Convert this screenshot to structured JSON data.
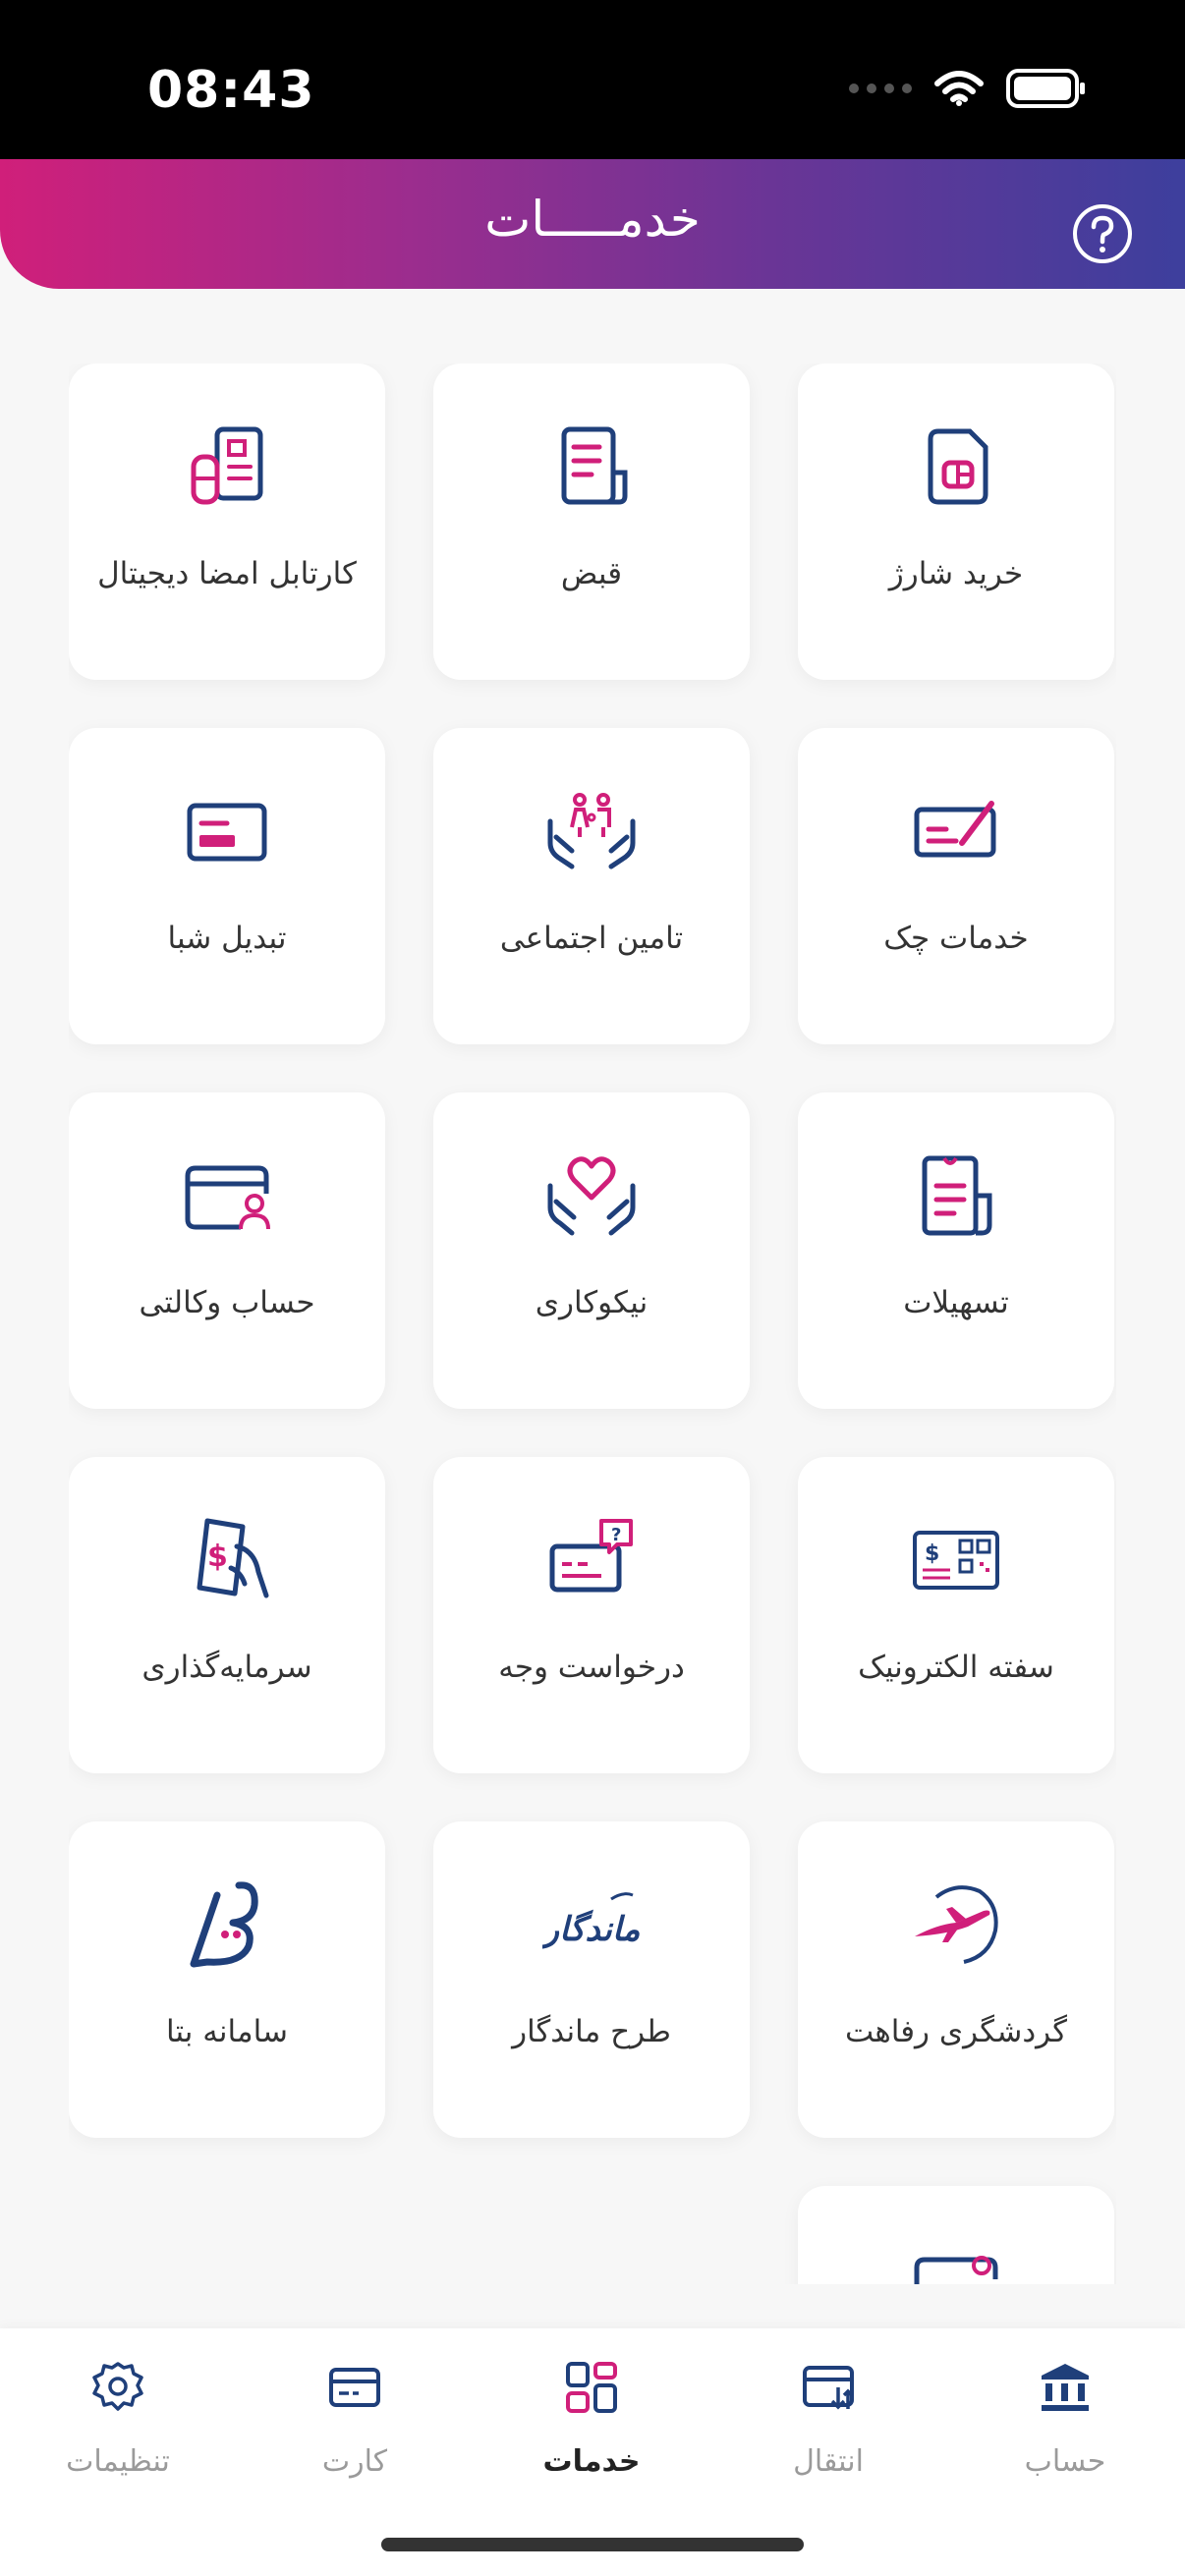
{
  "status_bar": {
    "time": "08:43"
  },
  "header": {
    "title": "خدمـــــات"
  },
  "services": [
    {
      "label": "خرید شارژ",
      "icon": "sim-card-icon"
    },
    {
      "label": "قبض",
      "icon": "bill-icon"
    },
    {
      "label": "کارتابل امضا دیجیتال",
      "icon": "digital-signature-icon"
    },
    {
      "label": "خدمات چک",
      "icon": "cheque-icon"
    },
    {
      "label": "تامین اجتماعی",
      "icon": "social-security-icon"
    },
    {
      "label": "تبدیل شبا",
      "icon": "sheba-card-icon"
    },
    {
      "label": "تسهیلات",
      "icon": "facilities-icon"
    },
    {
      "label": "نیکوکاری",
      "icon": "charity-icon"
    },
    {
      "label": "حساب وکالتی",
      "icon": "proxy-account-icon"
    },
    {
      "label": "سفته الکترونیک",
      "icon": "electronic-promissory-icon"
    },
    {
      "label": "درخواست وجه",
      "icon": "money-request-icon"
    },
    {
      "label": "سرمایه‌گذاری",
      "icon": "investment-icon"
    },
    {
      "label": "گردشگری رفاهت",
      "icon": "tourism-icon"
    },
    {
      "label": "طرح ماندگار",
      "icon": "mandegar-logo-icon"
    },
    {
      "label": "سامانه بتا",
      "icon": "beta-logo-icon"
    }
  ],
  "bottom_nav": [
    {
      "label": "حساب",
      "icon": "bank-icon"
    },
    {
      "label": "انتقال",
      "icon": "transfer-icon"
    },
    {
      "label": "خدمات",
      "icon": "services-grid-icon",
      "active": true
    },
    {
      "label": "کارت",
      "icon": "card-icon"
    },
    {
      "label": "تنظیمات",
      "icon": "gear-icon"
    }
  ],
  "colors": {
    "pink": "#d01f7a",
    "navy": "#1f3f7a",
    "purple": "#6a3596"
  }
}
